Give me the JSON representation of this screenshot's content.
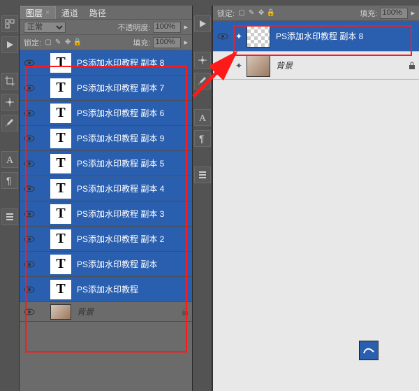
{
  "topbar": "▸ ◀◀",
  "left_panel": {
    "tabs": {
      "layers": "图层",
      "channels": "通道",
      "paths": "路径"
    },
    "mode": "正常",
    "opacity_label": "不透明度:",
    "opacity_value": "100%",
    "lock_label": "锁定:",
    "fill_label": "填充:",
    "fill_value": "100%",
    "layers": [
      {
        "name": "PS添加水印教程 副本 8",
        "type": "T",
        "selected": true
      },
      {
        "name": "PS添加水印教程 副本 7",
        "type": "T",
        "selected": true
      },
      {
        "name": "PS添加水印教程 副本 6",
        "type": "T",
        "selected": true
      },
      {
        "name": "PS添加水印教程 副本 9",
        "type": "T",
        "selected": true
      },
      {
        "name": "PS添加水印教程 副本 5",
        "type": "T",
        "selected": true
      },
      {
        "name": "PS添加水印教程 副本 4",
        "type": "T",
        "selected": true
      },
      {
        "name": "PS添加水印教程 副本 3",
        "type": "T",
        "selected": true
      },
      {
        "name": "PS添加水印教程 副本 2",
        "type": "T",
        "selected": true
      },
      {
        "name": "PS添加水印教程 副本",
        "type": "T",
        "selected": true
      },
      {
        "name": "PS添加水印教程",
        "type": "T",
        "selected": true
      }
    ],
    "bg_layer": "背景"
  },
  "right_panel": {
    "lock_label": "锁定:",
    "fill_label": "填充:",
    "fill_value": "100%",
    "merged_layer": "PS添加水印教程 副本 8",
    "bg_layer": "背景"
  },
  "tool_icons": [
    "move",
    "play",
    "crop",
    "wand",
    "brush",
    "type",
    "para",
    "menu"
  ],
  "colors": {
    "selection": "#2a5fb0",
    "panel": "#6b6b6b",
    "highlight": "#ff1a1a"
  }
}
